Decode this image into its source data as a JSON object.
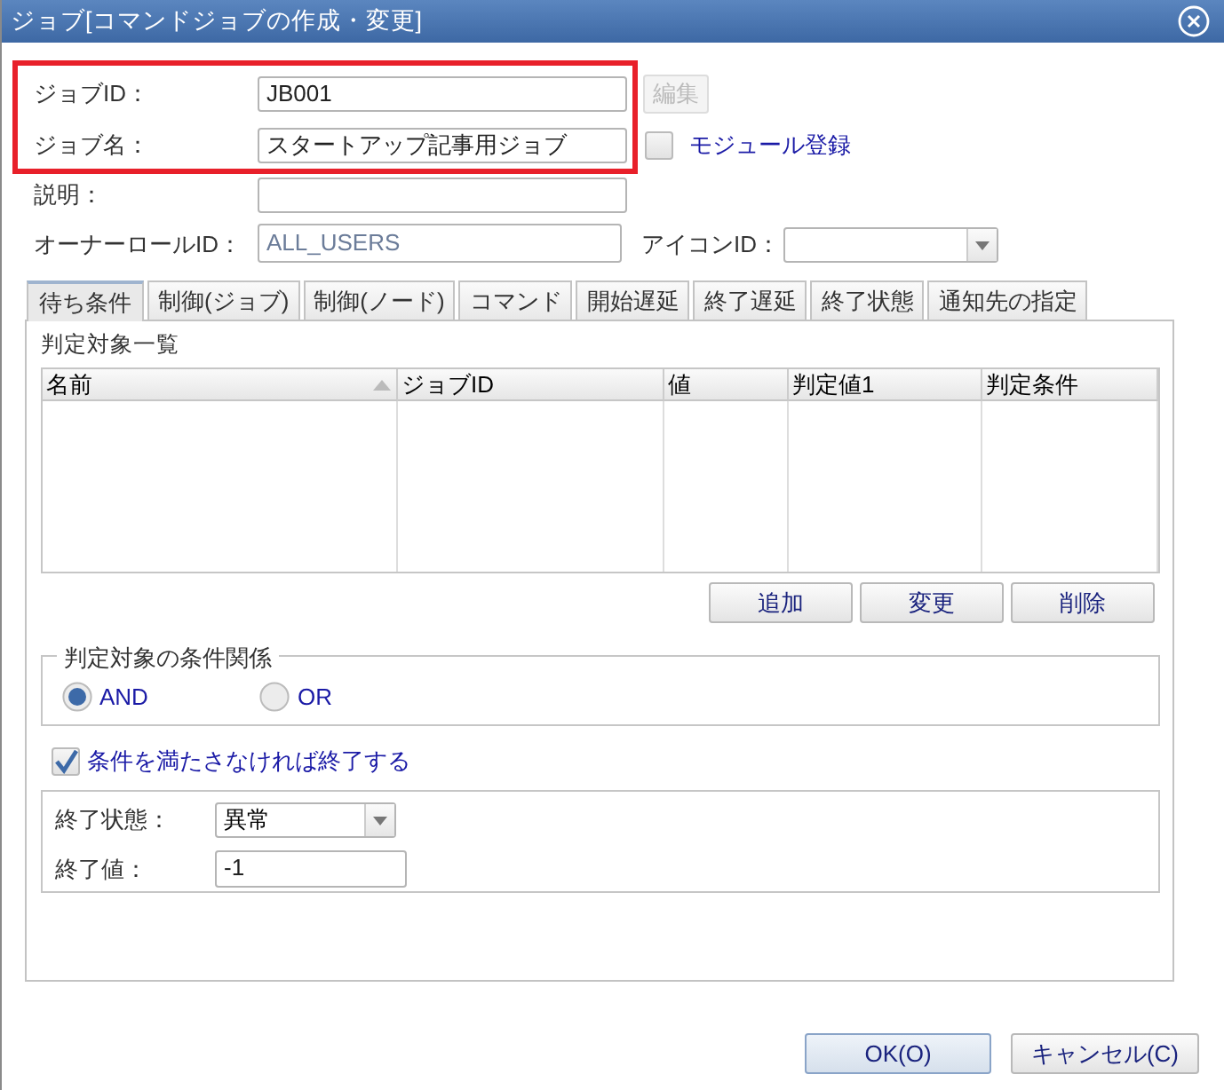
{
  "window": {
    "title": "ジョブ[コマンドジョブの作成・変更]"
  },
  "job_id": {
    "label": "ジョブID：",
    "value": "JB001"
  },
  "edit_button": {
    "label": "編集",
    "disabled": true
  },
  "job_name": {
    "label": "ジョブ名：",
    "value": "スタートアップ記事用ジョブ"
  },
  "module_registration": {
    "label": "モジュール登録",
    "checked": false
  },
  "description": {
    "label": "説明："
  },
  "owner_role_id": {
    "label": "オーナーロールID：",
    "value": "ALL_USERS"
  },
  "icon_id": {
    "label": "アイコンID："
  },
  "tabs": [
    {
      "label": "待ち条件",
      "selected": true
    },
    {
      "label": "制御(ジョブ)",
      "selected": false
    },
    {
      "label": "制御(ノード)",
      "selected": false
    },
    {
      "label": "コマンド",
      "selected": false
    },
    {
      "label": "開始遅延",
      "selected": false
    },
    {
      "label": "終了遅延",
      "selected": false
    },
    {
      "label": "終了状態",
      "selected": false
    },
    {
      "label": "通知先の指定",
      "selected": false
    }
  ],
  "wait_conditions": {
    "list_title": "判定対象一覧",
    "table": {
      "columns": [
        {
          "label": "名前",
          "sorted": true
        },
        {
          "label": "ジョブID",
          "sorted": false
        },
        {
          "label": "値",
          "sorted": false
        },
        {
          "label": "判定値1",
          "sorted": false
        },
        {
          "label": "判定条件",
          "sorted": false
        }
      ]
    },
    "buttons": [
      "追加",
      "変更",
      "削除"
    ],
    "condition_relation": {
      "legend": "判定対象の条件関係",
      "options": [
        {
          "label": "AND",
          "selected": true
        },
        {
          "label": "OR",
          "selected": false
        }
      ]
    },
    "end_if_unmet": {
      "label": "条件を満たさなければ終了する",
      "checked": true
    },
    "end_status": {
      "label": "終了状態：",
      "value": "異常"
    },
    "end_value": {
      "label": "終了値：",
      "value": "-1"
    }
  },
  "buttons": [
    "OK(O)",
    "キャンセル(C)"
  ]
}
